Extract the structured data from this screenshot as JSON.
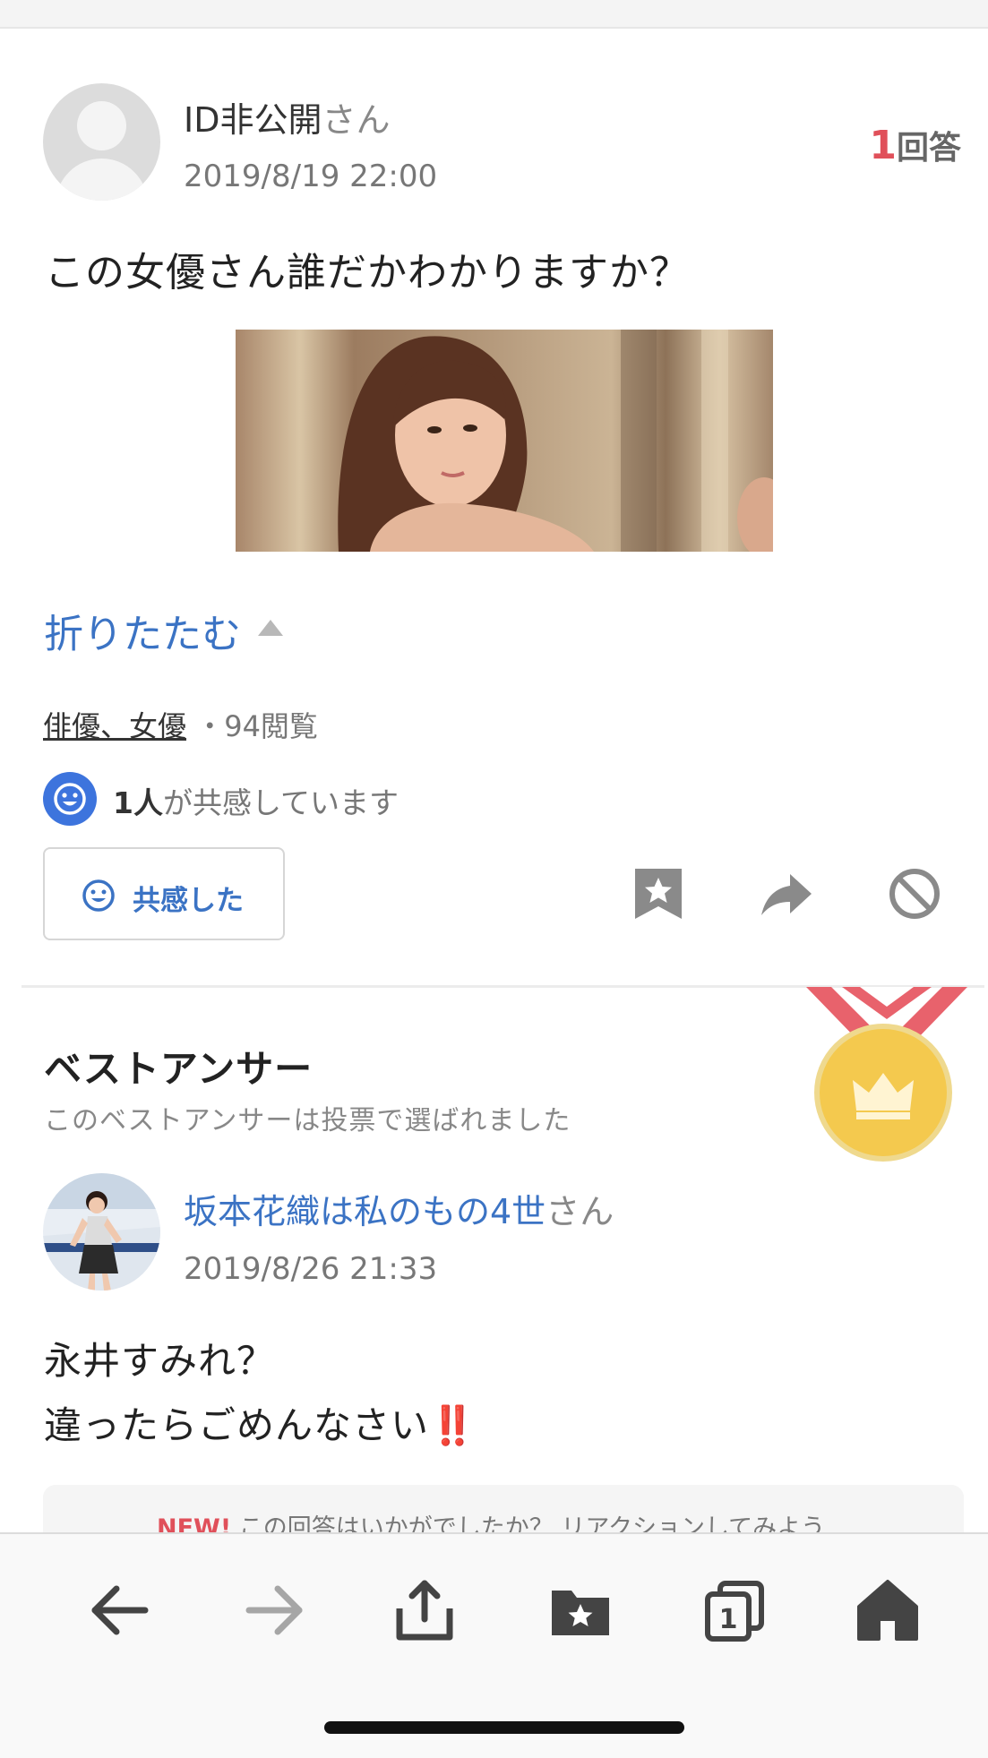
{
  "question": {
    "user_name": "ID非公開",
    "honorific": "さん",
    "date": "2019/8/19 22:00",
    "answer_count": "1",
    "answer_count_label": "回答",
    "text": "この女優さん誰だかわかりますか？",
    "collapse_label": "折りたたむ",
    "category": "俳優、女優",
    "separator": "・",
    "views": "94",
    "views_label": "閲覧",
    "empathy_count": "1人",
    "empathy_suffix": "が共感しています",
    "empathy_button_label": "共感した"
  },
  "best_answer": {
    "title": "ベストアンサー",
    "subtitle": "このベストアンサーは投票で選ばれました",
    "user_name": "坂本花織は私のもの4世",
    "honorific": "さん",
    "date": "2019/8/26 21:33",
    "line1": "永井すみれ？",
    "line2": "違ったらごめんなさい",
    "line2_emoji": "‼️",
    "reaction_new": "NEW!",
    "reaction_prompt": "この回答はいかがでしたか？ リアクションしてみよう"
  },
  "toolbar": {
    "tabs_count": "1"
  },
  "colors": {
    "link_blue": "#3b73c4",
    "accent_red": "#e0505a",
    "badge_blue": "#3d74dd",
    "medal_gold": "#f4c94e",
    "ribbon_red": "#e8626c"
  }
}
